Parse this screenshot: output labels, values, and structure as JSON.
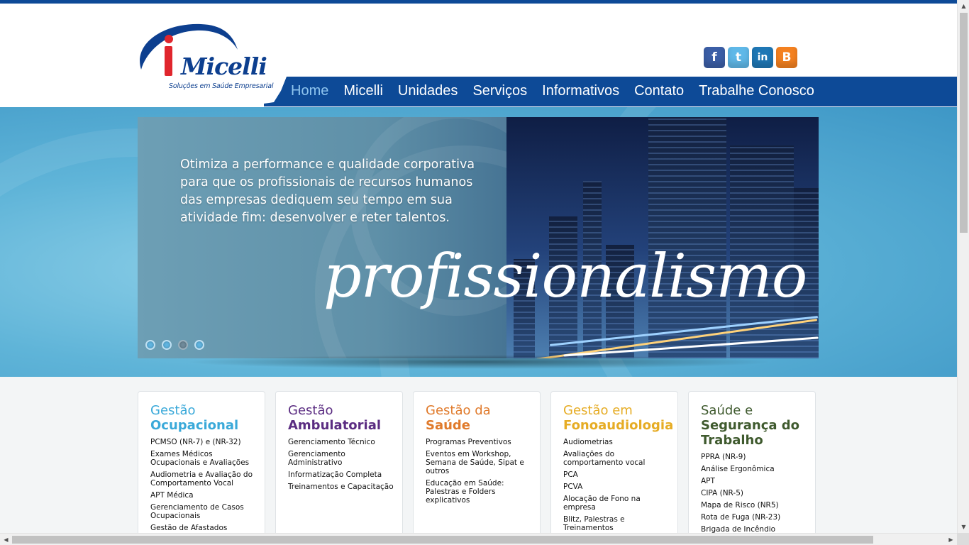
{
  "brand": {
    "name": "Micelli",
    "initial": "i",
    "tagline": "Soluções em Saúde Empresarial",
    "colors": {
      "primary": "#0d4a97",
      "accent_red": "#e0262d"
    }
  },
  "social": [
    {
      "icon": "facebook-icon",
      "glyph": "f"
    },
    {
      "icon": "twitter-icon",
      "glyph": "t"
    },
    {
      "icon": "linkedin-icon",
      "glyph": "in"
    },
    {
      "icon": "blogger-icon",
      "glyph": "B"
    }
  ],
  "nav": {
    "items": [
      {
        "label": "Home",
        "active": true
      },
      {
        "label": "Micelli"
      },
      {
        "label": "Unidades"
      },
      {
        "label": "Serviços"
      },
      {
        "label": "Informativos"
      },
      {
        "label": "Contato"
      },
      {
        "label": "Trabalhe Conosco"
      }
    ]
  },
  "hero": {
    "text": "Otimiza a performance e qualidade corporativa para que os profissionais de recursos humanos das empresas dediquem seu tempo em sua atividade fim: desenvolver e reter talentos.",
    "script_word": "profissionalismo",
    "slider_dots": 4,
    "active_dot": 1
  },
  "cards": [
    {
      "title1": "Gestão",
      "title2": "Ocupacional",
      "color": "#3aa9d9",
      "items": [
        "PCMSO (NR-7) e (NR-32)",
        "Exames Médicos Ocupacionais e Avaliações",
        "Audiometria e Avaliação do Comportamento Vocal",
        "APT Médica",
        "Gerenciamento de Casos Ocupacionais",
        "Gestão de Afastados"
      ]
    },
    {
      "title1": "Gestão",
      "title2": "Ambulatorial",
      "color": "#5b2d82",
      "items": [
        "Gerenciamento Técnico",
        "Gerenciamento Administrativo",
        "Informatização Completa",
        "Treinamentos e Capacitação"
      ]
    },
    {
      "title1": "Gestão da",
      "title2": "Saúde",
      "color": "#e07a2b",
      "items": [
        "Programas Preventivos",
        "Eventos em Workshop, Semana de Saúde, Sipat e outros",
        "Educação em Saúde: Palestras e Folders explicativos"
      ]
    },
    {
      "title1": "Gestão em",
      "title2": "Fonoaudiologia",
      "color": "#e6ac24",
      "items": [
        "Audiometrias",
        "Avaliações do comportamento vocal",
        "PCA",
        "PCVA",
        "Alocação de Fono na empresa",
        "Blitz, Palestras e Treinamentos"
      ]
    },
    {
      "title1": "Saúde e",
      "title2": "Segurança do Trabalho",
      "color": "#3f5a2e",
      "items": [
        "PPRA (NR-9)",
        "Análise Ergonômica",
        "APT",
        "CIPA (NR-5)",
        "Mapa de Risco (NR5)",
        "Rota de Fuga (NR-23)",
        "Brigada de Incêndio"
      ]
    }
  ]
}
